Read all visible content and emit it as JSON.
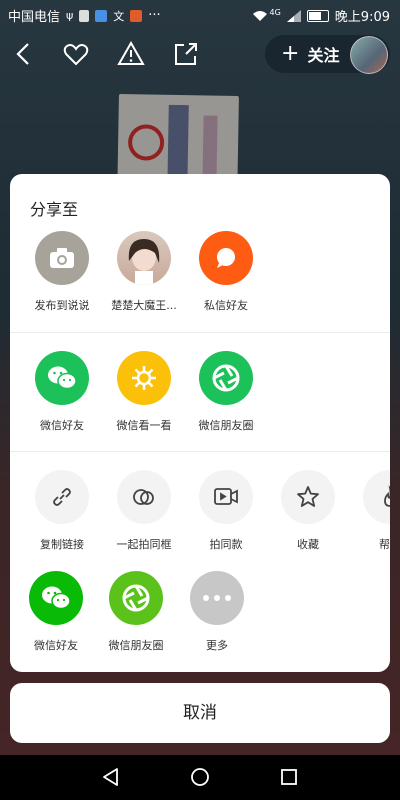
{
  "status_bar": {
    "carrier": "中国电信",
    "network": "4G",
    "time": "晚上9:09"
  },
  "header": {
    "follow_label": "关注"
  },
  "share_sheet": {
    "title": "分享至",
    "row1": [
      {
        "label": "发布到说说",
        "icon": "camera-icon",
        "color": "#a8a39a"
      },
      {
        "label": "楚楚大魔王...",
        "icon": "avatar",
        "color": "#ccc"
      },
      {
        "label": "私信好友",
        "icon": "chat-bubble-icon",
        "color": "#fe5c13"
      }
    ],
    "row2": [
      {
        "label": "微信好友",
        "icon": "wechat-icon",
        "color": "#1cc159"
      },
      {
        "label": "微信看一看",
        "icon": "wechat-look-icon",
        "color": "#fbc10a"
      },
      {
        "label": "微信朋友圈",
        "icon": "moments-icon",
        "color": "#1cc159"
      }
    ],
    "row3": [
      {
        "label": "复制链接",
        "icon": "link-icon"
      },
      {
        "label": "一起拍同框",
        "icon": "duet-icon"
      },
      {
        "label": "拍同款",
        "icon": "video-camera-icon"
      },
      {
        "label": "收藏",
        "icon": "star-icon"
      },
      {
        "label": "帮他",
        "icon": "flame-icon"
      }
    ],
    "row4": [
      {
        "label": "微信好友",
        "icon": "wechat-icon",
        "color": "#09bb07"
      },
      {
        "label": "微信朋友圈",
        "icon": "moments-icon",
        "color": "#5ac21b"
      },
      {
        "label": "更多",
        "icon": "more-icon",
        "color": "#c7c7c7"
      }
    ]
  },
  "cancel_label": "取消"
}
